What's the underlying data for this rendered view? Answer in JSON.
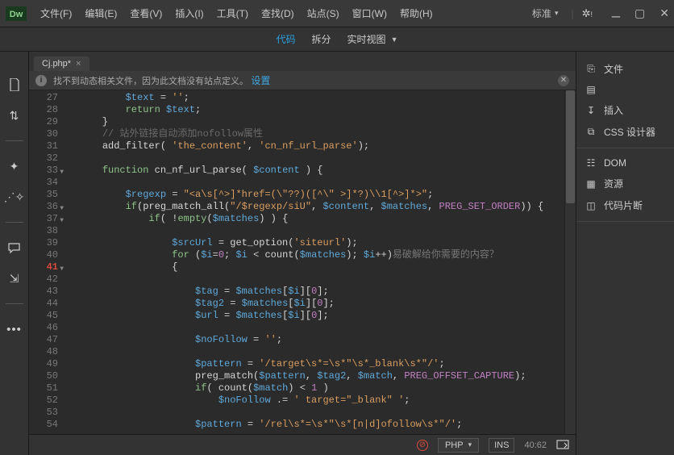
{
  "titlebar": {
    "menus": [
      "文件(F)",
      "编辑(E)",
      "查看(V)",
      "插入(I)",
      "工具(T)",
      "查找(D)",
      "站点(S)",
      "窗口(W)",
      "帮助(H)"
    ],
    "standard_label": "标准"
  },
  "viewbar": {
    "code": "代码",
    "split": "拆分",
    "live": "实时视图"
  },
  "tab": {
    "label": "Cj.php*"
  },
  "infobar": {
    "text": "找不到动态相关文件，因为此文档没有站点定义。",
    "link": "设置"
  },
  "right_panel": {
    "section1": [
      "文件",
      "CC Libraries",
      "插入",
      "CSS 设计器"
    ],
    "section2": [
      "DOM",
      "资源",
      "代码片断"
    ]
  },
  "statusbar": {
    "lang": "PHP",
    "ins": "INS",
    "pos": "40:62"
  },
  "code": {
    "lines": [
      {
        "n": 27,
        "html": "        <span class='var'>$text</span> <span class='op'>=</span> <span class='str'>''</span>;"
      },
      {
        "n": 28,
        "html": "        <span class='kw'>return</span> <span class='var'>$text</span>;"
      },
      {
        "n": 29,
        "html": "    }"
      },
      {
        "n": 30,
        "html": "    <span class='cm'>// 站外链接自动添加nofollow属性</span>"
      },
      {
        "n": 31,
        "html": "    <span class='fn'>add_filter</span>( <span class='str'>'the_content'</span>, <span class='str'>'cn_nf_url_parse'</span>);"
      },
      {
        "n": 32,
        "html": ""
      },
      {
        "n": 33,
        "fold": true,
        "html": "    <span class='kw'>function</span> <span class='fn'>cn_nf_url_parse</span>( <span class='var'>$content</span> ) {"
      },
      {
        "n": 34,
        "html": ""
      },
      {
        "n": 35,
        "html": "        <span class='var'>$regexp</span> <span class='op'>=</span> <span class='str'>\"&lt;a\\s[^&gt;]*href=(\\\"??)([^\\\" &gt;]*?)\\\\1[^&gt;]*&gt;\"</span>;"
      },
      {
        "n": 36,
        "fold": true,
        "html": "        <span class='kw'>if</span>(<span class='fn'>preg_match_all</span>(<span class='str'>\"/$regexp/siU\"</span>, <span class='var'>$content</span>, <span class='var'>$matches</span>, <span class='const'>PREG_SET_ORDER</span>)) {"
      },
      {
        "n": 37,
        "fold": true,
        "html": "            <span class='kw'>if</span>( !<span class='kw'>empty</span>(<span class='var'>$matches</span>) ) {"
      },
      {
        "n": 38,
        "html": ""
      },
      {
        "n": 39,
        "html": "                <span class='var'>$srcUrl</span> <span class='op'>=</span> <span class='fn'>get_option</span>(<span class='str'>'siteurl'</span>);"
      },
      {
        "n": 40,
        "html": "                <span class='kw'>for</span> (<span class='var'>$i</span><span class='op'>=</span><span class='num'>0</span>; <span class='var'>$i</span> <span class='op'>&lt;</span> <span class='fn'>count</span>(<span class='var'>$matches</span>); <span class='var'>$i</span><span class='op'>++</span>)<span class='hint'>易破解给你需要的内容？</span>"
      },
      {
        "n": 41,
        "err": true,
        "fold": true,
        "html": "                {"
      },
      {
        "n": 42,
        "html": ""
      },
      {
        "n": 43,
        "html": "                    <span class='var'>$tag</span> <span class='op'>=</span> <span class='var'>$matches</span>[<span class='var'>$i</span>][<span class='num'>0</span>];"
      },
      {
        "n": 44,
        "html": "                    <span class='var'>$tag2</span> <span class='op'>=</span> <span class='var'>$matches</span>[<span class='var'>$i</span>][<span class='num'>0</span>];"
      },
      {
        "n": 45,
        "html": "                    <span class='var'>$url</span> <span class='op'>=</span> <span class='var'>$matches</span>[<span class='var'>$i</span>][<span class='num'>0</span>];"
      },
      {
        "n": 46,
        "html": ""
      },
      {
        "n": 47,
        "html": "                    <span class='var'>$noFollow</span> <span class='op'>=</span> <span class='str'>''</span>;"
      },
      {
        "n": 48,
        "html": ""
      },
      {
        "n": 49,
        "html": "                    <span class='var'>$pattern</span> <span class='op'>=</span> <span class='str'>'/target\\s*=\\s*\"\\s*_blank\\s*\"/'</span>;"
      },
      {
        "n": 50,
        "html": "                    <span class='fn'>preg_match</span>(<span class='var'>$pattern</span>, <span class='var'>$tag2</span>, <span class='var'>$match</span>, <span class='const'>PREG_OFFSET_CAPTURE</span>);"
      },
      {
        "n": 51,
        "html": "                    <span class='kw'>if</span>( <span class='fn'>count</span>(<span class='var'>$match</span>) <span class='op'>&lt;</span> <span class='num'>1</span> )"
      },
      {
        "n": 52,
        "html": "                        <span class='var'>$noFollow</span> <span class='op'>.=</span> <span class='str'>' target=\"_blank\" '</span>;"
      },
      {
        "n": 53,
        "html": ""
      },
      {
        "n": 54,
        "html": "                    <span class='var'>$pattern</span> <span class='op'>=</span> <span class='str'>'/rel\\s*=\\s*\"\\s*[n|d]ofollow\\s*\"/'</span>;"
      }
    ]
  }
}
